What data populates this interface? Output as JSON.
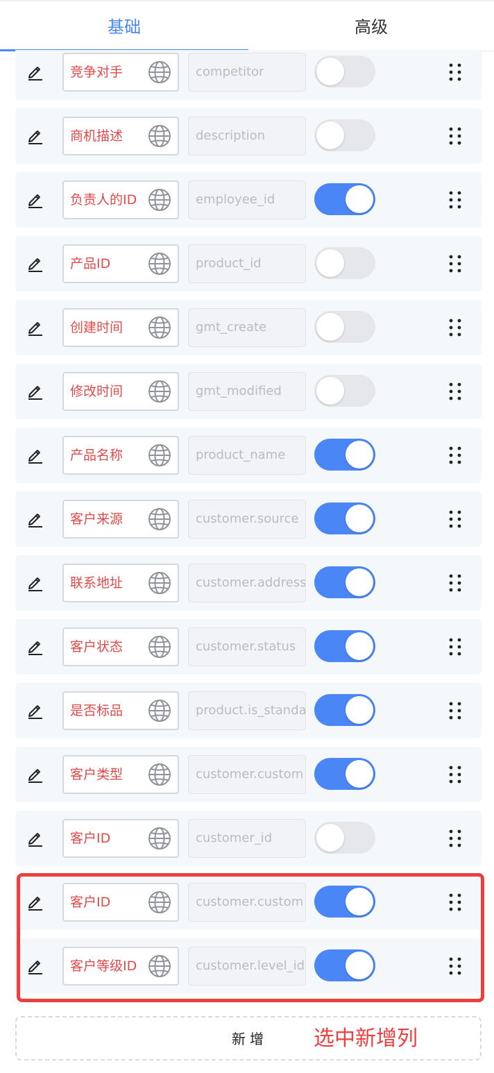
{
  "tabs": [
    {
      "label": "基础",
      "active": true
    },
    {
      "label": "高级",
      "active": false
    }
  ],
  "colors": {
    "accent": "#4a86f5",
    "name_text": "#e04a4a",
    "highlight": "#ef3e3e",
    "toggle_off": "#e6e7ea",
    "row_bg": "#f5f8fb"
  },
  "icons": {
    "edit": "pencil-icon",
    "i18n": "globe-icon",
    "drag": "drag-handle-icon"
  },
  "fields": [
    {
      "name": "竞争对手",
      "key": "competitor",
      "enabled": false
    },
    {
      "name": "商机描述",
      "key": "description",
      "enabled": false
    },
    {
      "name": "负责人的ID",
      "key": "employee_id",
      "enabled": true
    },
    {
      "name": "产品ID",
      "key": "product_id",
      "enabled": false
    },
    {
      "name": "创建时间",
      "key": "gmt_create",
      "enabled": false
    },
    {
      "name": "修改时间",
      "key": "gmt_modified",
      "enabled": false
    },
    {
      "name": "产品名称",
      "key": "product_name",
      "enabled": true
    },
    {
      "name": "客户来源",
      "key": "customer.source",
      "enabled": true
    },
    {
      "name": "联系地址",
      "key": "customer.address",
      "enabled": true
    },
    {
      "name": "客户状态",
      "key": "customer.status",
      "enabled": true
    },
    {
      "name": "是否标品",
      "key": "product.is_standa",
      "enabled": true
    },
    {
      "name": "客户类型",
      "key": "customer.custom",
      "enabled": true
    },
    {
      "name": "客户ID",
      "key": "customer_id",
      "enabled": false
    },
    {
      "name": "客户ID",
      "key": "customer.custom",
      "enabled": true
    },
    {
      "name": "客户等级ID",
      "key": "customer.level_id",
      "enabled": true
    }
  ],
  "add_button": {
    "label": "新增"
  },
  "annotation": {
    "label": "选中新增列"
  }
}
